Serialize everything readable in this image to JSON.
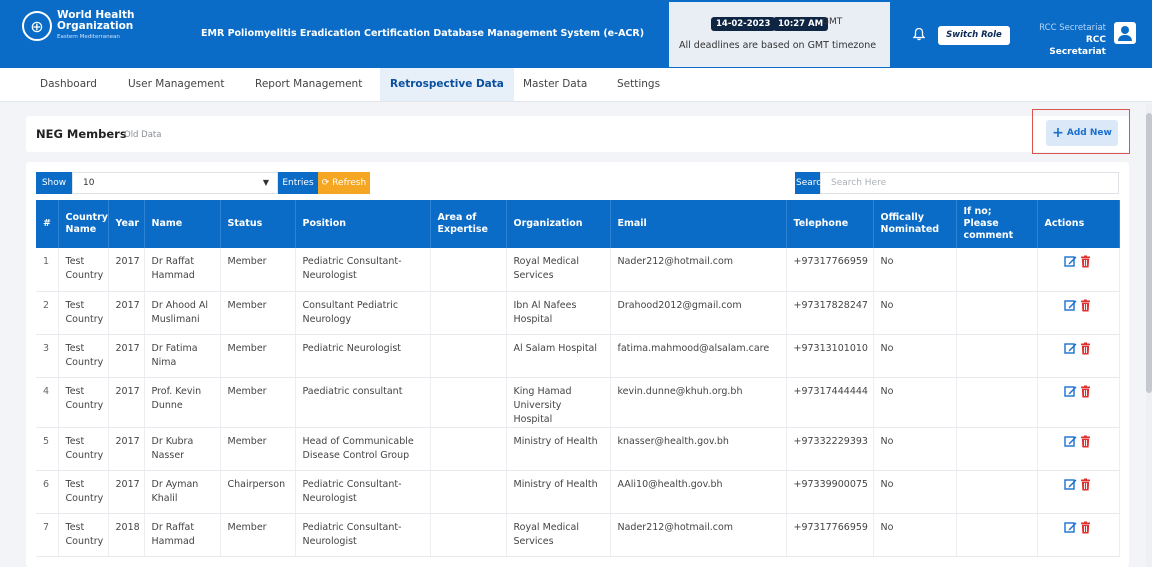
{
  "header": {
    "logo": {
      "line1": "World Health",
      "line2": "Organization",
      "line3": "Eastern Mediterranean"
    },
    "system_title": "EMR Poliomyelitis Eradication Certification Database Management System (e-ACR)",
    "date": "14-02-2023",
    "time": "10:27 AM",
    "timezone": "GMT",
    "deadline_note": "All deadlines are based on GMT timezone",
    "switch_role_label": "Switch Role",
    "user_role_top": "RCC Secretariat",
    "user_role_bottom": "RCC Secretariat"
  },
  "nav": {
    "items": [
      {
        "label": "Dashboard"
      },
      {
        "label": "User Management"
      },
      {
        "label": "Report Management"
      },
      {
        "label": "Retrospective Data",
        "active": true
      },
      {
        "label": "Master Data"
      },
      {
        "label": "Settings"
      }
    ]
  },
  "section": {
    "title": "NEG Members",
    "subtitle": "Old Data",
    "add_new_label": "Add New"
  },
  "controls": {
    "show_label": "Show",
    "show_value": "10",
    "entries_label": "Entries",
    "refresh_label": "Refresh",
    "search_label": "Search:",
    "search_placeholder": "Search Here"
  },
  "table": {
    "columns": [
      "#",
      "Country Name",
      "Year",
      "Name",
      "Status",
      "Position",
      "Area of Expertise",
      "Organization",
      "Email",
      "Telephone",
      "Offically Nominated",
      "If no; Please comment",
      "Actions"
    ],
    "rows": [
      {
        "num": "1",
        "country": "Test Country",
        "year": "2017",
        "name": "Dr Raffat Hammad",
        "status": "Member",
        "position": "Pediatric Consultant- Neurologist",
        "area": "",
        "org": "Royal Medical Services",
        "email": "Nader212@hotmail.com",
        "tel": "+97317766959",
        "nominated": "No",
        "comment": ""
      },
      {
        "num": "2",
        "country": "Test Country",
        "year": "2017",
        "name": "Dr Ahood Al Muslimani",
        "status": "Member",
        "position": "Consultant Pediatric Neurology",
        "area": "",
        "org": "Ibn Al Nafees Hospital",
        "email": "Drahood2012@gmail.com",
        "tel": "+97317828247",
        "nominated": "No",
        "comment": ""
      },
      {
        "num": "3",
        "country": "Test Country",
        "year": "2017",
        "name": "Dr Fatima Nima",
        "status": "Member",
        "position": "Pediatric Neurologist",
        "area": "",
        "org": "Al Salam Hospital",
        "email": "fatima.mahmood@alsalam.care",
        "tel": "+97313101010",
        "nominated": "No",
        "comment": ""
      },
      {
        "num": "4",
        "country": "Test Country",
        "year": "2017",
        "name": "Prof. Kevin Dunne",
        "status": "Member",
        "position": "Paediatric consultant",
        "area": "",
        "org": "King Hamad University Hospital",
        "email": "kevin.dunne@khuh.org.bh",
        "tel": "+97317444444",
        "nominated": "No",
        "comment": ""
      },
      {
        "num": "5",
        "country": "Test Country",
        "year": "2017",
        "name": "Dr Kubra Nasser",
        "status": "Member",
        "position": "Head of Communicable Disease Control Group",
        "area": "",
        "org": "Ministry of Health",
        "email": "knasser@health.gov.bh",
        "tel": "+97332229393",
        "nominated": "No",
        "comment": ""
      },
      {
        "num": "6",
        "country": "Test Country",
        "year": "2017",
        "name": "Dr Ayman Khalil",
        "status": "Chairperson",
        "position": "Pediatric Consultant- Neurologist",
        "area": "",
        "org": "Ministry of Health",
        "email": "AAli10@health.gov.bh",
        "tel": "+97339900075",
        "nominated": "No",
        "comment": ""
      },
      {
        "num": "7",
        "country": "Test Country",
        "year": "2018",
        "name": "Dr Raffat Hammad",
        "status": "Member",
        "position": "Pediatric Consultant- Neurologist",
        "area": "",
        "org": "Royal Medical Services",
        "email": "Nader212@hotmail.com",
        "tel": "+97317766959",
        "nominated": "No",
        "comment": ""
      }
    ]
  },
  "colors": {
    "primary": "#0a6cc7",
    "refresh": "#f5a623",
    "edit_icon": "#1a6fcf",
    "delete_icon": "#e03131",
    "highlight_border": "#d9534f"
  }
}
